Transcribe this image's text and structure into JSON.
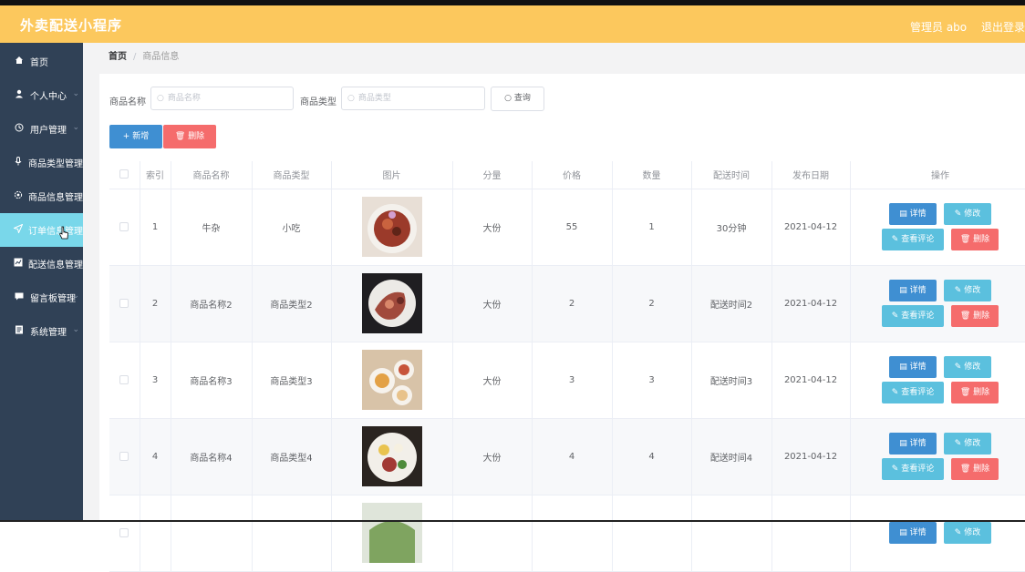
{
  "header": {
    "title": "外卖配送小程序",
    "admin_label": "管理员 abo",
    "logout_label": "退出登录"
  },
  "sidebar": {
    "items": [
      {
        "label": "首页",
        "icon": "home-icon"
      },
      {
        "label": "个人中心",
        "icon": "user-icon"
      },
      {
        "label": "用户管理",
        "icon": "clock-icon"
      },
      {
        "label": "商品类型管理",
        "icon": "mic-icon"
      },
      {
        "label": "商品信息管理",
        "icon": "gear-icon"
      },
      {
        "label": "订单信息管理",
        "icon": "send-icon"
      },
      {
        "label": "配送信息管理",
        "icon": "chart-icon"
      },
      {
        "label": "留言板管理",
        "icon": "message-icon"
      },
      {
        "label": "系统管理",
        "icon": "document-icon"
      }
    ]
  },
  "breadcrumb": {
    "home": "首页",
    "separator": "/",
    "current": "商品信息"
  },
  "search": {
    "name_label": "商品名称",
    "name_placeholder": "商品名称",
    "type_label": "商品类型",
    "type_placeholder": "商品类型",
    "query_label": "查询"
  },
  "actions": {
    "add_label": "新增",
    "delete_label": "删除"
  },
  "table": {
    "headers": [
      "索引",
      "商品名称",
      "商品类型",
      "图片",
      "分量",
      "价格",
      "数量",
      "配送时间",
      "发布日期",
      "操作"
    ],
    "rows": [
      {
        "index": "1",
        "name": "牛杂",
        "type": "小吃",
        "portion": "大份",
        "price": "55",
        "qty": "1",
        "delivery": "30分钟",
        "date": "2021-04-12"
      },
      {
        "index": "2",
        "name": "商品名称2",
        "type": "商品类型2",
        "portion": "大份",
        "price": "2",
        "qty": "2",
        "delivery": "配送时间2",
        "date": "2021-04-12"
      },
      {
        "index": "3",
        "name": "商品名称3",
        "type": "商品类型3",
        "portion": "大份",
        "price": "3",
        "qty": "3",
        "delivery": "配送时间3",
        "date": "2021-04-12"
      },
      {
        "index": "4",
        "name": "商品名称4",
        "type": "商品类型4",
        "portion": "大份",
        "price": "4",
        "qty": "4",
        "delivery": "配送时间4",
        "date": "2021-04-12"
      }
    ],
    "ops": {
      "detail": "详情",
      "edit": "修改",
      "review": "查看评论",
      "delete": "删除"
    }
  },
  "colors": {
    "header": "#fcc85d",
    "sidebar": "#304156",
    "sidebar_active": "#79d7ea",
    "primary": "#3f8fd2",
    "info": "#5bc0de",
    "danger": "#f56c6c"
  }
}
